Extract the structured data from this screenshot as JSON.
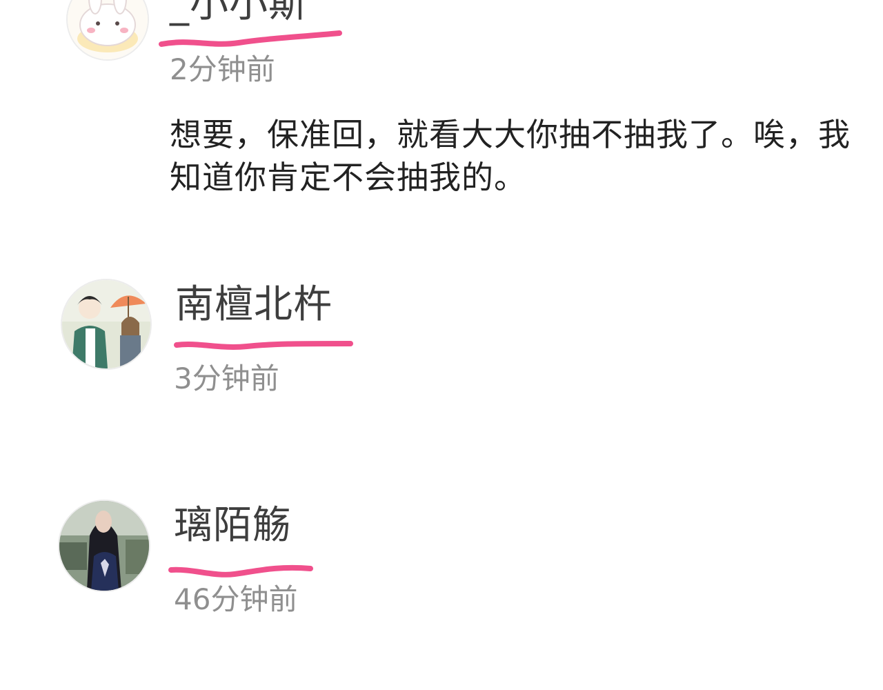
{
  "comments": [
    {
      "username": "_小小斯",
      "time": "2分钟前",
      "text": "想要，保准回，就看大大你抽不抽我了。唉，我知道你肯定不会抽我的。",
      "avatar_icon": "bunny-avatar-icon"
    },
    {
      "username": "南檀北杵",
      "time": "3分钟前",
      "text": "",
      "avatar_icon": "anime-boy-umbrella-avatar-icon"
    },
    {
      "username": "璃陌觞",
      "time": "46分钟前",
      "text": "",
      "avatar_icon": "girl-photo-avatar-icon"
    }
  ],
  "colors": {
    "underline": "#f0508c",
    "username": "#3e3e3e",
    "timestamp": "#8f8f8f",
    "body_text": "#222222"
  }
}
